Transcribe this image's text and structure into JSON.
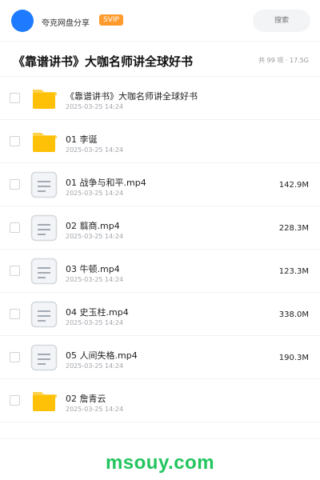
{
  "header": {
    "app_name": "夸克网盘分享",
    "badge": "SVIP",
    "search_placeholder": "搜索"
  },
  "title_bar": {
    "title": "《靠谱讲书》大咖名师讲全球好书",
    "summary": "共 99 项 · 17.5G"
  },
  "colors": {
    "accent": "#1e7bff",
    "badge": "#ff9b2d",
    "folder": "#ffc107",
    "watermark": "#22c55e"
  },
  "files": [
    {
      "type": "folder",
      "icon": "folder-icon",
      "name": "《靠谱讲书》大咖名师讲全球好书",
      "date": "2025-03-25 14:24",
      "size": ""
    },
    {
      "type": "folder",
      "icon": "folder-icon",
      "name": "01 李诞",
      "date": "2025-03-25 14:24",
      "size": ""
    },
    {
      "type": "file",
      "icon": "video-file-icon",
      "name": "01 战争与和平.mp4",
      "date": "2025-03-25 14:24",
      "size": "142.9M"
    },
    {
      "type": "file",
      "icon": "video-file-icon",
      "name": "02 翦商.mp4",
      "date": "2025-03-25 14:24",
      "size": "228.3M"
    },
    {
      "type": "file",
      "icon": "video-file-icon",
      "name": "03 牛顿.mp4",
      "date": "2025-03-25 14:24",
      "size": "123.3M"
    },
    {
      "type": "file",
      "icon": "video-file-icon",
      "name": "04 史玉柱.mp4",
      "date": "2025-03-25 14:24",
      "size": "338.0M"
    },
    {
      "type": "file",
      "icon": "video-file-icon",
      "name": "05 人间失格.mp4",
      "date": "2025-03-25 14:24",
      "size": "190.3M"
    },
    {
      "type": "folder",
      "icon": "folder-icon",
      "name": "02 詹青云",
      "date": "2025-03-25 14:24",
      "size": ""
    }
  ],
  "footer": {
    "watermark": "msouy.com"
  }
}
